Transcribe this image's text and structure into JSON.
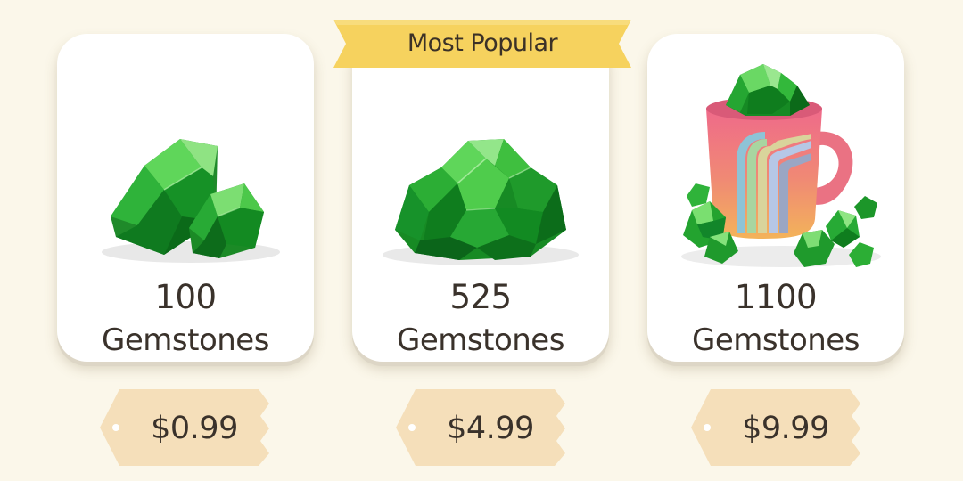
{
  "badge": {
    "label": "Most Popular"
  },
  "offers": [
    {
      "amount": "100",
      "unit": "Gemstones",
      "price": "$0.99",
      "icon": "gem-pair-icon"
    },
    {
      "amount": "525",
      "unit": "Gemstones",
      "price": "$4.99",
      "icon": "gem-pile-icon"
    },
    {
      "amount": "1100",
      "unit": "Gemstones",
      "price": "$9.99",
      "icon": "rainbow-mug-gems-icon"
    }
  ],
  "colors": {
    "background": "#fbf7ea",
    "card": "#ffffff",
    "ribbon": "#f6d25e",
    "price_tag": "#f5dfba",
    "gem_green": "#2ea82e",
    "text": "#3a322b"
  }
}
